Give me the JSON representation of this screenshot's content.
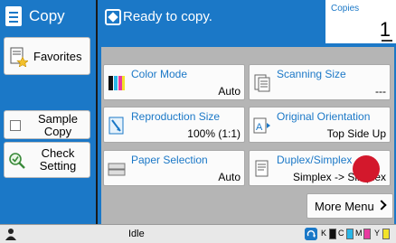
{
  "header": {
    "title": "Copy"
  },
  "status": {
    "message": "Ready to copy."
  },
  "copies": {
    "label": "Copies",
    "value": "1"
  },
  "sidebar": {
    "favorites_label": "Favorites",
    "sample_copy_label": "Sample Copy",
    "check_setting_label": "Check Setting"
  },
  "tiles": {
    "color_mode": {
      "label": "Color Mode",
      "value": "Auto"
    },
    "scanning_size": {
      "label": "Scanning Size",
      "value": "---"
    },
    "reproduction_size": {
      "label": "Reproduction Size",
      "value": "100% (1:1)"
    },
    "original_orientation": {
      "label": "Original Orientation",
      "value": "Top Side Up"
    },
    "paper_selection": {
      "label": "Paper Selection",
      "value": "Auto"
    },
    "duplex_simplex": {
      "label": "Duplex/Simplex",
      "value": "Simplex -> Simplex"
    }
  },
  "more_menu_label": "More Menu",
  "bottom": {
    "state": "Idle",
    "toners": [
      {
        "label": "K",
        "color": "#111111"
      },
      {
        "label": "C",
        "color": "#29b6e8"
      },
      {
        "label": "M",
        "color": "#e83aa0"
      },
      {
        "label": "Y",
        "color": "#f2e32a"
      }
    ]
  },
  "colors": {
    "accent": "#1b78c7",
    "indicator": "#d3182c"
  }
}
